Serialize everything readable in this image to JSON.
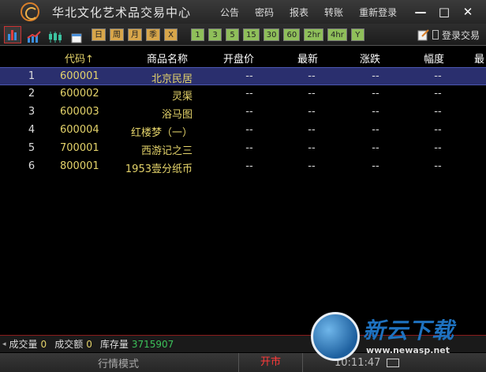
{
  "window": {
    "title": "华北文化艺术品交易中心",
    "menu": [
      "公告",
      "密码",
      "报表",
      "转账",
      "重新登录"
    ],
    "controls": [
      "—",
      "□",
      "✕"
    ]
  },
  "toolbar": {
    "period_buttons": [
      "日",
      "周",
      "月",
      "季",
      "X",
      "1",
      "3",
      "5",
      "15",
      "30",
      "60",
      "2hr",
      "4hr",
      "Y"
    ],
    "login_label": "登录交易"
  },
  "table": {
    "headers": [
      "代码↑",
      "商品名称",
      "开盘价",
      "最新",
      "涨跌",
      "幅度",
      "最"
    ],
    "rows": [
      {
        "idx": "1",
        "code": "600001",
        "name": "北京民居",
        "open": "--",
        "latest": "--",
        "change": "--",
        "pct": "--"
      },
      {
        "idx": "2",
        "code": "600002",
        "name": "灵渠",
        "open": "--",
        "latest": "--",
        "change": "--",
        "pct": "--"
      },
      {
        "idx": "3",
        "code": "600003",
        "name": "浴马图",
        "open": "--",
        "latest": "--",
        "change": "--",
        "pct": "--"
      },
      {
        "idx": "4",
        "code": "600004",
        "name": "红楼梦（一）",
        "open": "--",
        "latest": "--",
        "change": "--",
        "pct": "--"
      },
      {
        "idx": "5",
        "code": "700001",
        "name": "西游记之三",
        "open": "--",
        "latest": "--",
        "change": "--",
        "pct": "--"
      },
      {
        "idx": "6",
        "code": "800001",
        "name": "1953壹分纸币",
        "open": "--",
        "latest": "--",
        "change": "--",
        "pct": "--"
      }
    ]
  },
  "status": {
    "volume_label": "成交量",
    "volume": "0",
    "amount_label": "成交额",
    "amount": "0",
    "stock_label": "库存量",
    "stock": "3715907"
  },
  "bottom": {
    "mode": "行情模式",
    "market": "开市",
    "time": "10:11:47"
  },
  "watermark": {
    "brand": "新云下载",
    "url": "www.newasp.net"
  },
  "colors": {
    "accent_red": "#ff3a3a",
    "code_yellow": "#e4d36a",
    "stock_green": "#3cc25a",
    "selected_row": "#2a2f6e"
  }
}
